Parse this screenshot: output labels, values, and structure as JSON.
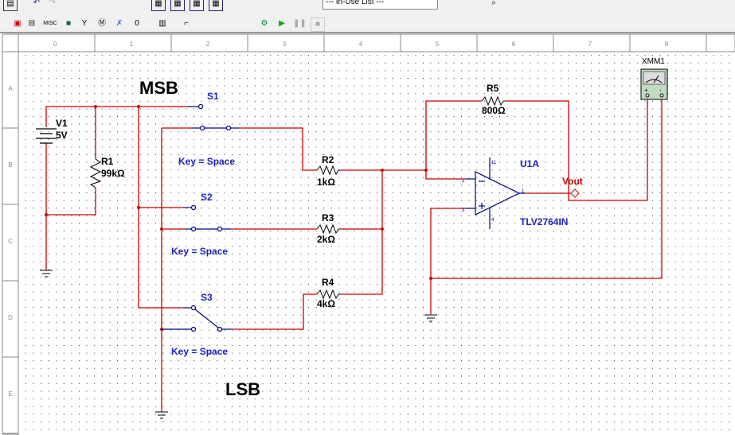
{
  "toolbar": {
    "instrument_list": "--- In-Use List ---",
    "misc_label": "MISC",
    "run_icon": "run-icon",
    "pause_icon": "pause-icon",
    "stop_icon": "stop-icon"
  },
  "rulers": {
    "columns": [
      "0",
      "1",
      "2",
      "3",
      "4",
      "5",
      "6",
      "7",
      "8"
    ],
    "rows": [
      "A",
      "B",
      "C",
      "D",
      "E"
    ]
  },
  "schematic": {
    "msb": "MSB",
    "lsb": "LSB",
    "v1": {
      "name": "V1",
      "value": "5V"
    },
    "r1": {
      "name": "R1",
      "value": "99kΩ"
    },
    "r2": {
      "name": "R2",
      "value": "1kΩ"
    },
    "r3": {
      "name": "R3",
      "value": "2kΩ"
    },
    "r4": {
      "name": "R4",
      "value": "4kΩ"
    },
    "r5": {
      "name": "R5",
      "value": "800Ω"
    },
    "s1": {
      "name": "S1",
      "key": "Key = Space"
    },
    "s2": {
      "name": "S2",
      "key": "Key = Space"
    },
    "s3": {
      "name": "S3",
      "key": "Key = Space"
    },
    "u1": {
      "name": "U1A",
      "part": "TLV2764IN",
      "pins": {
        "in_minus": "2",
        "in_plus": "3",
        "out": "1",
        "vplus": "11",
        "vminus": "4"
      }
    },
    "vout": "Vout",
    "xmm": {
      "name": "XMM1"
    },
    "colors": {
      "wire": "#cc0000",
      "component": "#000080",
      "label": "#2020c0",
      "net": "#d00000"
    }
  }
}
